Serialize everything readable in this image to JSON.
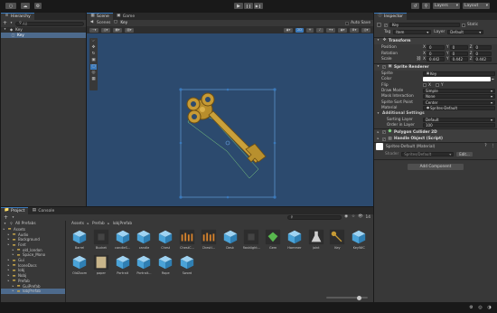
{
  "colors": {
    "accent": "#3a79bb",
    "sceneBg": "#2c4a6e",
    "panel": "#383838",
    "dark": "#191919"
  },
  "toolbar": {
    "layers_label": "Layers",
    "layout_label": "Layout"
  },
  "hierarchy": {
    "tab_label": "Hierarchy",
    "search_placeholder": "All",
    "scene_name": "Key",
    "child_name": "Key"
  },
  "scene": {
    "scene_tab": "Scene",
    "game_tab": "Game",
    "auto_save": "Auto Save",
    "breadcrumb_root": "Scenes",
    "breadcrumb_leaf": "Key",
    "view_mode": "2D"
  },
  "inspector": {
    "tab_label": "Inspector",
    "object_name": "Key",
    "static_label": "Static",
    "tag_label": "Tag",
    "tag_value": "Item",
    "layer_label": "Layer",
    "layer_value": "Default",
    "transform": {
      "title": "Transform",
      "position_label": "Position",
      "rotation_label": "Rotation",
      "scale_label": "Scale",
      "position": [
        "0",
        "0",
        "0"
      ],
      "rotation": [
        "0",
        "0",
        "0"
      ],
      "scale": [
        "0.442",
        "0.442",
        "0.442"
      ],
      "axes": [
        "X",
        "Y",
        "Z"
      ]
    },
    "sprite_renderer": {
      "title": "Sprite Renderer",
      "sprite_label": "Sprite",
      "sprite_value": "Key",
      "color_label": "Color",
      "flip_label": "Flip",
      "flip_x": "X",
      "flip_y": "Y",
      "draw_mode_label": "Draw Mode",
      "draw_mode_value": "Simple",
      "mask_label": "Mask Interaction",
      "mask_value": "None",
      "sort_point_label": "Sprite Sort Point",
      "sort_point_value": "Center",
      "material_label": "Material",
      "material_value": "Sprites-Default",
      "additional_label": "Additional Settings",
      "sorting_layer_label": "Sorting Layer",
      "sorting_layer_value": "Default",
      "order_label": "Order in Layer",
      "order_value": "100"
    },
    "polygon_collider": "Polygon Collider 2D",
    "handle_object": "Handle Object (Script)",
    "material_asset": "Sprites-Default (Material)",
    "shader_label": "Shader",
    "shader_value": "Sprites/Default",
    "edit_label": "Edit...",
    "add_component": "Add Component"
  },
  "project": {
    "project_tab": "Project",
    "console_tab": "Console",
    "all_prefabs": "All Prefabs",
    "tree": [
      {
        "label": "Assets",
        "indent": 0
      },
      {
        "label": "Audio",
        "indent": 1
      },
      {
        "label": "Background",
        "indent": 1
      },
      {
        "label": "Font",
        "indent": 1
      },
      {
        "label": "old_london",
        "indent": 2
      },
      {
        "label": "Space_Mono",
        "indent": 2
      },
      {
        "label": "Gui",
        "indent": 1
      },
      {
        "label": "IconeDocs",
        "indent": 1
      },
      {
        "label": "Iobj",
        "indent": 1
      },
      {
        "label": "Nobj",
        "indent": 1
      },
      {
        "label": "Prefab",
        "indent": 1
      },
      {
        "label": "GuiPrefab",
        "indent": 2
      },
      {
        "label": "lobjPrefab",
        "indent": 2
      }
    ],
    "breadcrumb": [
      "Assets",
      "Prefab",
      "lobjPrefab"
    ],
    "hidden_count": "14",
    "assets_row1": [
      {
        "label": "Barrel",
        "kind": "cube"
      },
      {
        "label": "Bucket",
        "kind": "dark"
      },
      {
        "label": "candleS...",
        "kind": "cube"
      },
      {
        "label": "candle",
        "kind": "cube"
      },
      {
        "label": "Chest",
        "kind": "cube"
      },
      {
        "label": "ChestC...",
        "kind": "orange"
      },
      {
        "label": "ChestI...",
        "kind": "orange"
      },
      {
        "label": "Desk",
        "kind": "cube"
      },
      {
        "label": "flashlight...",
        "kind": "dark"
      },
      {
        "label": "Gem",
        "kind": "green"
      },
      {
        "label": "Hammer",
        "kind": "cube"
      },
      {
        "label": "joint",
        "kind": "flask"
      },
      {
        "label": "Key",
        "kind": "key"
      },
      {
        "label": "KeyWIC",
        "kind": "cube"
      }
    ],
    "assets_row2": [
      {
        "label": "OldZoom",
        "kind": "cube"
      },
      {
        "label": "paper",
        "kind": "paper"
      },
      {
        "label": "Portrait",
        "kind": "cube"
      },
      {
        "label": "Portrait...",
        "kind": "cube"
      },
      {
        "label": "Rope",
        "kind": "cube"
      },
      {
        "label": "Sword",
        "kind": "cube"
      }
    ]
  }
}
